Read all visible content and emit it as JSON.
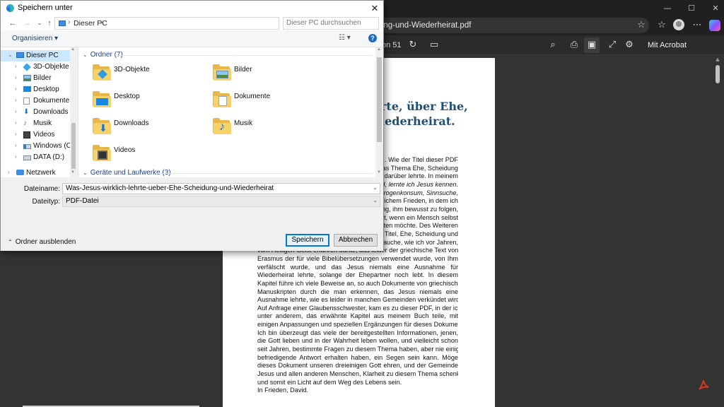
{
  "browser": {
    "url_text": "ung-und-Wiederheirat.pdf",
    "page_info": "on 51",
    "acrobat_edit": "Mit Acrobat bearbeiten",
    "window_controls": [
      "—",
      "☐",
      "✕"
    ]
  },
  "pdf": {
    "title_lines": [
      "rte, über Ehe,",
      "iederheirat."
    ],
    "lines": [
      {
        "t": ". Wie der Titel dieser PDF",
        "cls": "right"
      },
      {
        "t": "das Thema Ehe, Scheidung",
        "cls": "right"
      },
      {
        "t": "darüber lehrte. In meinem",
        "cls": "right"
      },
      {
        "t": "id, lernte ich Jesus kennen.",
        "cls": "right it"
      },
      {
        "t": "Drogenkonsum, Sinnsuche,",
        "cls": "right it"
      },
      {
        "t": "ttlichem Frieden, in dem ich",
        "cls": "right"
      },
      {
        "t": "ing, ihm bewusst zu folgen,",
        "cls": "right"
      },
      {
        "t": "st, wenn ein Mensch selbst",
        "cls": "right"
      },
      {
        "t": "alten möchte. Des Weiteren",
        "cls": "right"
      },
      {
        "t": "Titel, Ehe, Scheidung und",
        "cls": "right"
      },
      {
        "t": "e auche, wie ich vor Jahren,",
        "cls": "right"
      },
      {
        "t": "vom Heiligen Geist erfahren durfte, das leider der griechische Text von",
        "cls": ""
      },
      {
        "t": "Erasmus der für viele Bibelübersetzungen verwendet wurde, von Ihm",
        "cls": ""
      },
      {
        "t": "verfälscht wurde, und das Jesus niemals eine Ausnahme für",
        "cls": ""
      },
      {
        "t": "Wiederheirat lehrte, solange der Ehepartner noch lebt. In diesem",
        "cls": ""
      },
      {
        "t": "Kapitel führe ich viele Beweise an, so auch Dokumente von griechischen",
        "cls": ""
      },
      {
        "t": "Manuskripten durch die man erkennen, das Jesus niemals eine",
        "cls": ""
      },
      {
        "t": "Ausnahme lehrte, wie es leider in manchen Gemeinden verkündet wird.",
        "cls": ""
      },
      {
        "t": "Auf Anfrage einer Glaubensschwester, kam es zu dieser PDF, in der ich",
        "cls": ""
      },
      {
        "t": "unter anderem, das erwähnte Kapitel aus meinem Buch teile, mit",
        "cls": ""
      },
      {
        "t": "einigen Anpassungen und speziellen Ergänzungen für dieses Dokument.",
        "cls": ""
      },
      {
        "t": "Ich bin überzeugt das viele der bereitgestellten Informationen, jenen,",
        "cls": ""
      },
      {
        "t": "die Gott lieben und in der Wahrheit leben wollen, und vielleicht schon",
        "cls": ""
      },
      {
        "t": "seit Jahren, bestimmte Fragen zu diesem Thema haben, aber nie einige",
        "cls": ""
      },
      {
        "t": "befriedigende Antwort erhalten haben, ein Segen sein kann. Möge",
        "cls": ""
      },
      {
        "t": "dieses Dokument unseren dreieinigen Gott ehren, und der Gemeinde",
        "cls": ""
      },
      {
        "t": "Jesus und allen anderen Menschen, Klarheit zu diesem Thema schenken",
        "cls": ""
      },
      {
        "t": "und somit ein Licht auf dem Weg des Lebens sein.",
        "cls": "last"
      },
      {
        "t": "In Frieden, David.",
        "cls": "last"
      }
    ]
  },
  "dialog": {
    "title": "Speichern unter",
    "close": "✕",
    "path": "Dieser PC",
    "search_placeholder": "Dieser PC durchsuchen",
    "organise": "Organisieren ▾",
    "view_label": "☷ ▾",
    "help": "?",
    "nav_items": [
      {
        "label": "Dieser PC",
        "icon": "pc",
        "level": 0,
        "selected": true,
        "arrow": "⌄"
      },
      {
        "label": "3D-Objekte",
        "icon": "3d",
        "level": 1,
        "arrow": "›"
      },
      {
        "label": "Bilder",
        "icon": "pictures",
        "level": 1,
        "arrow": "›"
      },
      {
        "label": "Desktop",
        "icon": "desktop",
        "level": 1,
        "arrow": "›"
      },
      {
        "label": "Dokumente",
        "icon": "documents",
        "level": 1,
        "arrow": "›"
      },
      {
        "label": "Downloads",
        "icon": "downloads",
        "level": 1,
        "arrow": "›"
      },
      {
        "label": "Musik",
        "icon": "music",
        "level": 1,
        "arrow": "›"
      },
      {
        "label": "Videos",
        "icon": "videos",
        "level": 1,
        "arrow": "›"
      },
      {
        "label": "Windows (C:)",
        "icon": "drive-c",
        "level": 1,
        "arrow": "›"
      },
      {
        "label": "DATA (D:)",
        "icon": "drive-d",
        "level": 1,
        "arrow": "›"
      },
      {
        "label": "Netzwerk",
        "icon": "network",
        "level": 0,
        "arrow": "›"
      }
    ],
    "group_folders": "Ordner (7)",
    "group_drives": "Geräte und Laufwerke (3)",
    "folders": [
      {
        "name": "3D-Objekte",
        "icon": "3d"
      },
      {
        "name": "Bilder",
        "icon": "pictures"
      },
      {
        "name": "Desktop",
        "icon": "desktop"
      },
      {
        "name": "Dokumente",
        "icon": "documents"
      },
      {
        "name": "Downloads",
        "icon": "downloads"
      },
      {
        "name": "Musik",
        "icon": "music"
      },
      {
        "name": "Videos",
        "icon": "videos"
      }
    ],
    "filename_label": "Dateiname:",
    "filename_value": "Was-Jesus-wirklich-lehrte-ueber-Ehe-Scheidung-und-Wiederheirat",
    "filetype_label": "Dateityp:",
    "filetype_value": "PDF-Datei",
    "hide_folders": "Ordner ausblenden",
    "save_button": "Speichern",
    "cancel_button": "Abbrechen"
  },
  "colors": {
    "accent": "#0078d7",
    "folder": "#f7d26a",
    "pdf_title": "#1f4f74",
    "acrobat_red": "#d4361f"
  }
}
